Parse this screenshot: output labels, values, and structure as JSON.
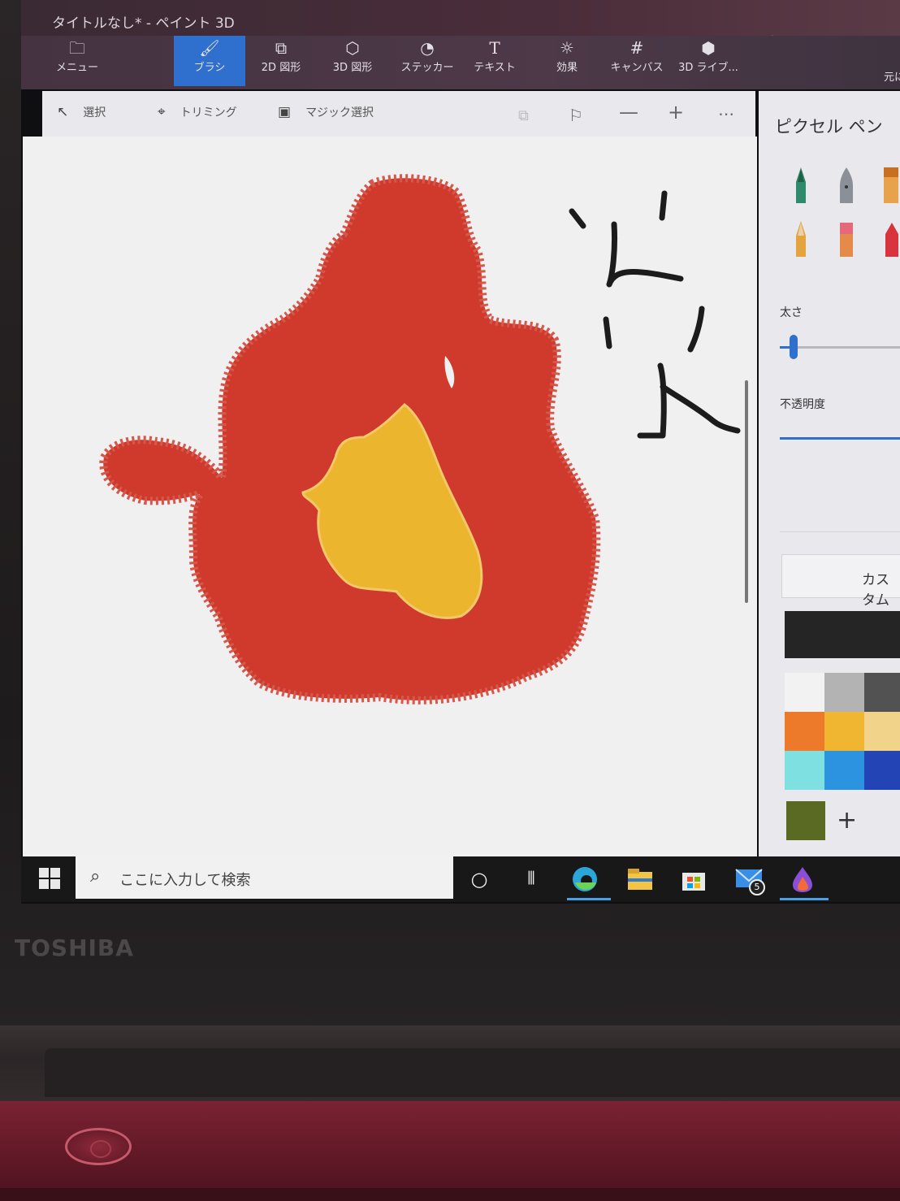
{
  "window": {
    "title": "タイトルなし* - ペイント 3D"
  },
  "ribbon": {
    "menu": "メニュー",
    "tabs": [
      {
        "label": "ブラシ",
        "icon": "brush-icon",
        "active": true
      },
      {
        "label": "2D 図形",
        "icon": "2d-shapes-icon",
        "active": false
      },
      {
        "label": "3D 図形",
        "icon": "3d-shapes-icon",
        "active": false
      },
      {
        "label": "ステッカー",
        "icon": "sticker-icon",
        "active": false
      },
      {
        "label": "テキスト",
        "icon": "text-icon",
        "active": false
      },
      {
        "label": "効果",
        "icon": "effects-icon",
        "active": false
      },
      {
        "label": "キャンバス",
        "icon": "canvas-icon",
        "active": false
      },
      {
        "label": "3D ライブ...",
        "icon": "3d-library-icon",
        "active": false
      }
    ],
    "right_cut": "元に"
  },
  "toolbar": {
    "select": "選択",
    "crop": "トリミング",
    "magic_select": "マジック選択"
  },
  "canvas": {
    "kanji": "炎",
    "colors": {
      "red": "#cf3a2c",
      "yellow": "#ecb52e",
      "ink": "#1c1c1c"
    }
  },
  "panel": {
    "title": "ピクセル ペン",
    "thickness_label": "太さ",
    "opacity_label": "不透明度",
    "custom_label": "カスタム",
    "current_color": "#262525",
    "palette": [
      [
        "#f2f2f2",
        "#b3b3b3",
        "#525252"
      ],
      [
        "#ed7a2a",
        "#f0b531",
        "#f2d38a"
      ],
      [
        "#7fe0e2",
        "#2c93e0",
        "#2244b5"
      ],
      [
        "#5a6a22"
      ]
    ],
    "add_color": "+"
  },
  "taskbar": {
    "search_placeholder": "ここに入力して検索",
    "mail_badge": "5"
  },
  "laptop": {
    "brand": "TOSHIBA"
  }
}
